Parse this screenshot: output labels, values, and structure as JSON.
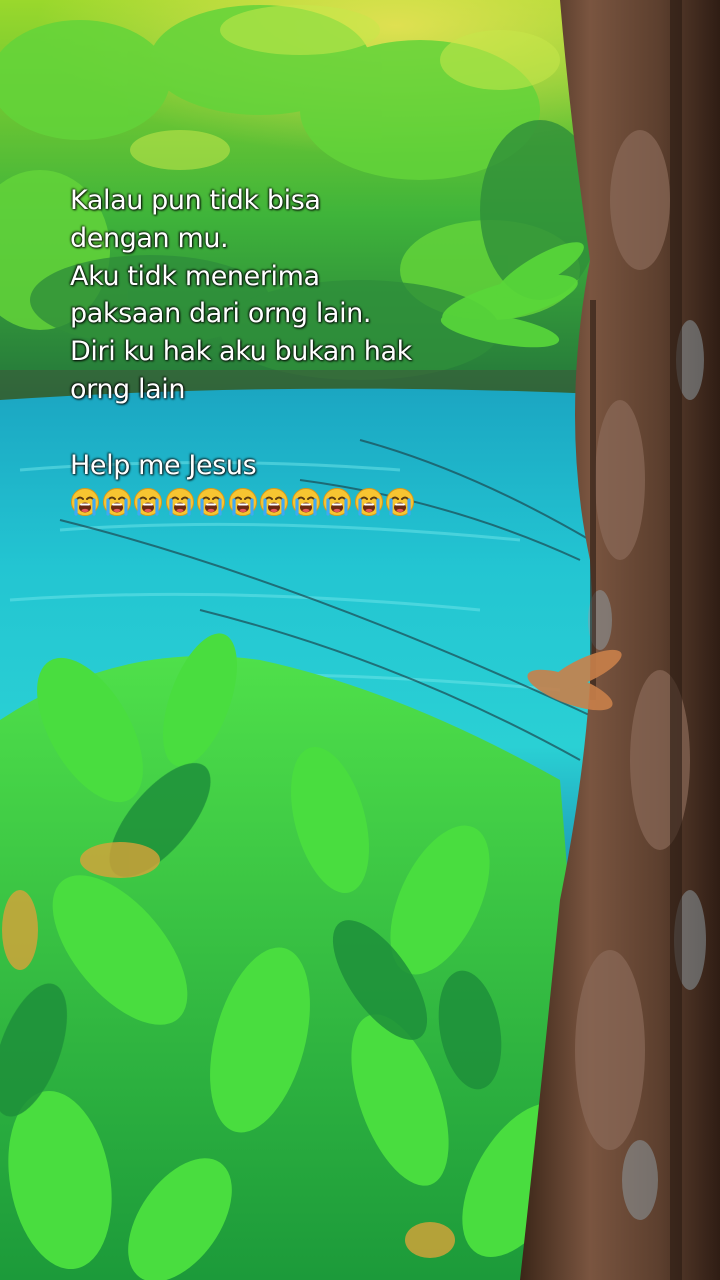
{
  "caption": {
    "lines": [
      "Kalau pun  tidk bisa",
      "dengan mu.",
      "Aku tidk menerima",
      "paksaan dari orng lain.",
      "Diri ku hak aku bukan hak",
      "orng lain"
    ],
    "closing": "Help me Jesus",
    "emoji_icon": "loudly-crying-face-icon",
    "emoji_count": 11
  },
  "colors": {
    "water": "#1fc4cf",
    "foliage": "#39d84a",
    "bark": "#6b4a36",
    "caption_text": "#ffffff"
  }
}
